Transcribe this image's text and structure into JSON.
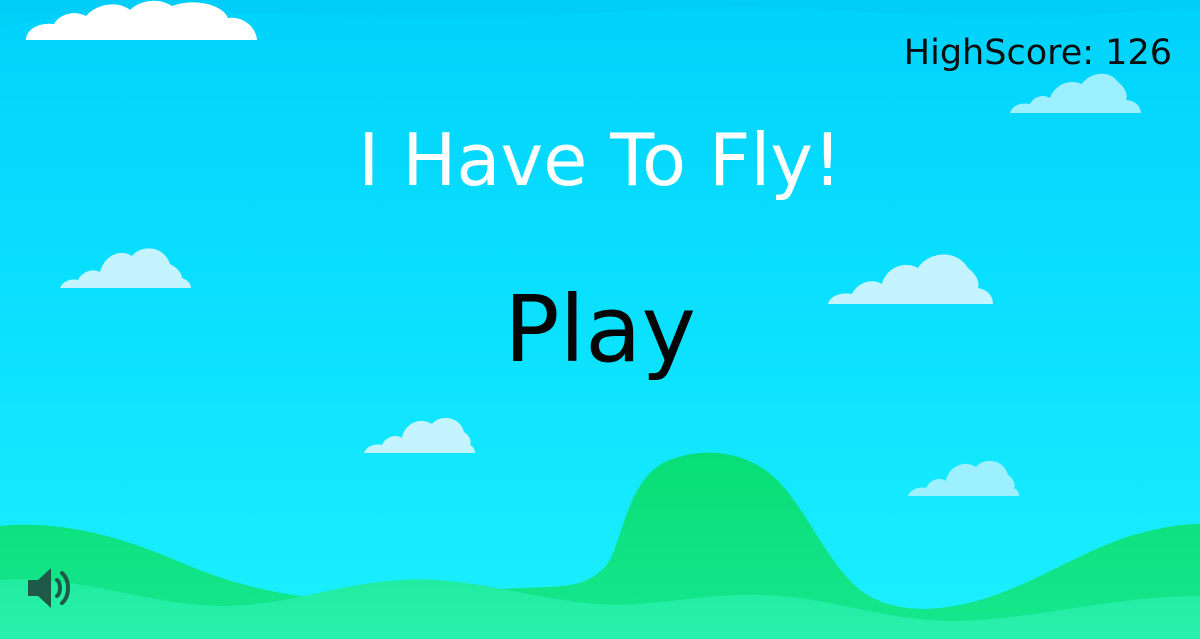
{
  "game": {
    "title": "I Have To Fly!",
    "highscore_label": "HighScore: 126",
    "play_label": "Play"
  },
  "icons": {
    "sound": "speaker-volume-icon"
  },
  "colors": {
    "sky_top": "#00D4FD",
    "sky_bottom": "#18EDFF",
    "cloud_white": "#FFFFFF",
    "cloud_light": "#C3F4FF",
    "cloud_aqua": "#9DF0FF",
    "hill_front": "#1EEA98",
    "hill_back": "#0EE07F",
    "sound_icon": "#1F5A48"
  }
}
